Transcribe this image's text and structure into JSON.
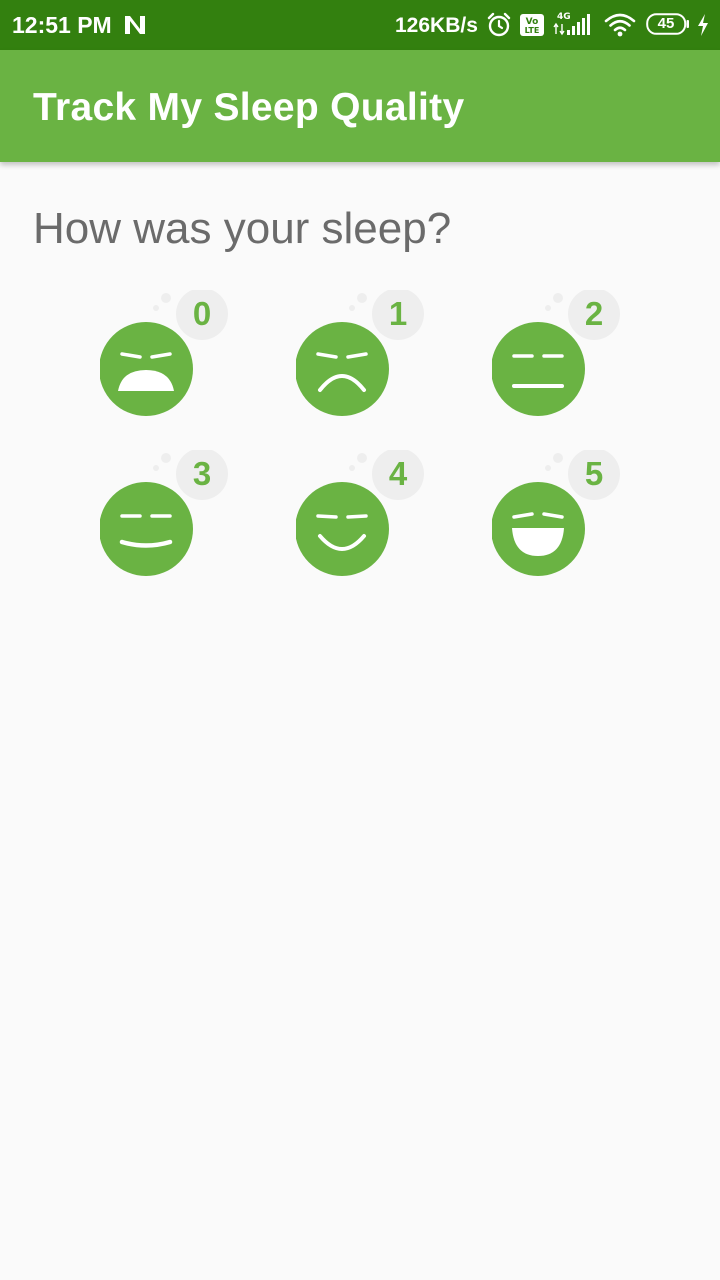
{
  "status_bar": {
    "time": "12:51 PM",
    "network_speed": "126KB/s",
    "battery_level": "45",
    "icons": [
      "n-icon",
      "alarm-icon",
      "volte-icon",
      "signal-4g-icon",
      "wifi-icon",
      "battery-icon",
      "charging-icon"
    ]
  },
  "app_bar": {
    "title": "Track My Sleep Quality"
  },
  "prompt": {
    "question": "How was your sleep?"
  },
  "sleep_options": [
    {
      "value": "0",
      "face": "very-sad-face-icon"
    },
    {
      "value": "1",
      "face": "sad-face-icon"
    },
    {
      "value": "2",
      "face": "neutral-face-icon"
    },
    {
      "value": "3",
      "face": "slight-smile-face-icon"
    },
    {
      "value": "4",
      "face": "smile-face-icon"
    },
    {
      "value": "5",
      "face": "big-smile-face-icon"
    }
  ],
  "colors": {
    "status_bar": "#33800f",
    "app_bar": "#6ab343",
    "face": "#6ab343",
    "badge": "#eeeeee",
    "background": "#fafafa",
    "question_text": "#6b6b6b"
  }
}
